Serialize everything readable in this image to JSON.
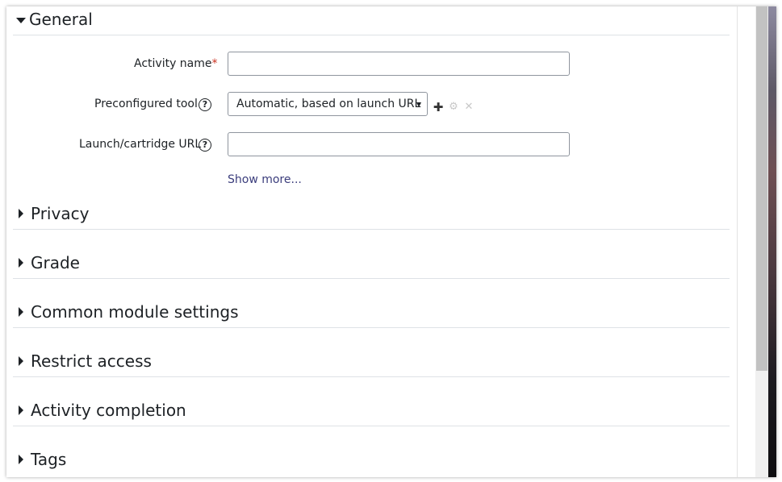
{
  "sections": {
    "general": {
      "title": "General",
      "expanded": true
    },
    "collapsed": [
      {
        "title": "Privacy"
      },
      {
        "title": "Grade"
      },
      {
        "title": "Common module settings"
      },
      {
        "title": "Restrict access"
      },
      {
        "title": "Activity completion"
      },
      {
        "title": "Tags"
      }
    ]
  },
  "form": {
    "activity_name": {
      "label": "Activity name",
      "required_marker": "*",
      "value": ""
    },
    "preconfigured_tool": {
      "label": "Preconfigured tool",
      "selected": "Automatic, based on launch URL",
      "help_icon": "question-circle-icon",
      "actions": [
        {
          "name": "add-tool-icon",
          "glyph": "✚",
          "color": "#333333"
        },
        {
          "name": "edit-tool-icon",
          "glyph": "⚙",
          "color": "#c8c8c8"
        },
        {
          "name": "delete-tool-icon",
          "glyph": "✕",
          "color": "#c8c8c8"
        }
      ]
    },
    "launch_url": {
      "label": "Launch/cartridge URL",
      "value": "",
      "help_icon": "question-circle-icon"
    },
    "show_more": "Show more..."
  },
  "colors": {
    "text": "#1d2125",
    "required": "#ca3120",
    "link": "#3b3d7c",
    "border": "#8f959e"
  }
}
